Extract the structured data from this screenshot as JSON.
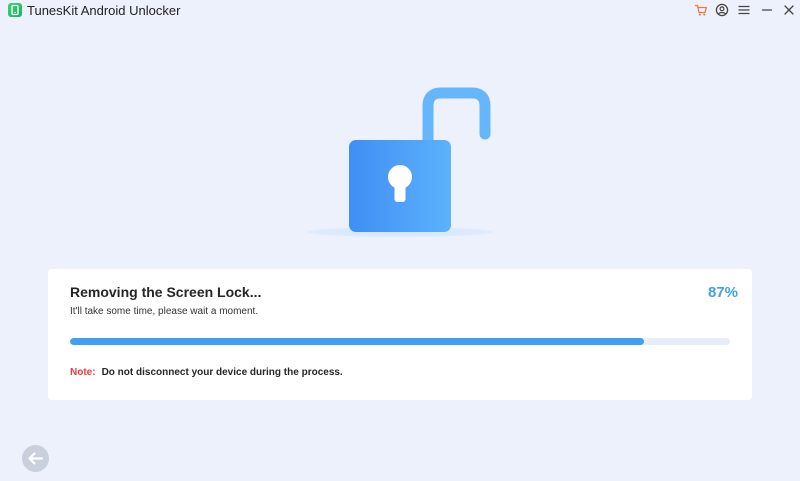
{
  "window": {
    "title": "TunesKit Android Unlocker",
    "controls": [
      "cart-icon",
      "account-icon",
      "menu-icon",
      "minimize-icon",
      "close-icon"
    ]
  },
  "progress": {
    "title": "Removing the Screen Lock...",
    "subtitle": "It'll take some time, please wait a moment.",
    "percent_label": "87%",
    "value": 0.87
  },
  "note": {
    "label": "Note:",
    "text": "Do not disconnect your device during the process."
  },
  "colors": {
    "background": "#ecf1fb",
    "accent": "#3fa0f0",
    "note_red": "#e83c3c",
    "cart_orange": "#f07a3a"
  },
  "navigation": {
    "back_icon": "arrow-left-icon"
  }
}
